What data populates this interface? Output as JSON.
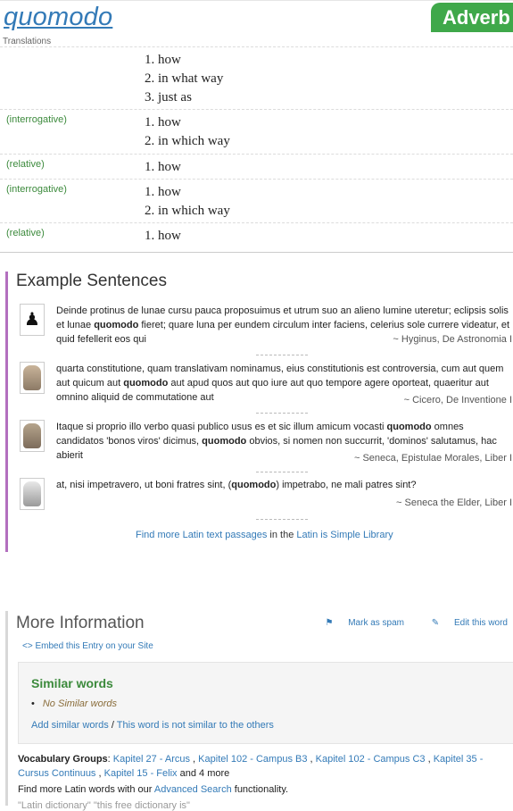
{
  "header": {
    "word": "quomodo",
    "part_of_speech": "Adverb",
    "translations_label": "Translations"
  },
  "translations": [
    {
      "context": "",
      "meanings": [
        "1. how",
        "2. in what way",
        "3. just as"
      ]
    },
    {
      "context": "(interrogative)",
      "meanings": [
        "1. how",
        "2. in which way"
      ]
    },
    {
      "context": "(relative)",
      "meanings": [
        "1. how"
      ]
    },
    {
      "context": "(interrogative)",
      "meanings": [
        "1. how",
        "2. in which way"
      ]
    },
    {
      "context": "(relative)",
      "meanings": [
        "1. how"
      ]
    }
  ],
  "examples": {
    "heading": "Example Sentences",
    "items": [
      {
        "pre": "Deinde protinus de lunae cursu pauca proposuimus et utrum suo an alieno lumine uteretur; eclipsis solis et lunae ",
        "bold1": "quomodo",
        "mid": " fieret; quare luna per eundem circulum inter faciens, celerius sole currere videatur, et quid fefellerit eos qui",
        "bold2": "",
        "post": "",
        "source": "~ Hyginus, De Astronomia I",
        "icon": "bust-icon"
      },
      {
        "pre": "quarta constitutione, quam translativam nominamus, eius constitutionis est controversia, cum aut quem aut quicum aut ",
        "bold1": "quomodo",
        "mid": " aut apud quos aut quo iure aut quo tempore agere oporteat, quaeritur aut omnino aliquid de commutatione aut",
        "bold2": "",
        "post": "",
        "source": "~ Cicero, De Inventione I",
        "icon": "portrait-icon"
      },
      {
        "pre": "Itaque si proprio illo verbo quasi publico usus es et sic illum amicum vocasti ",
        "bold1": "quomodo",
        "mid": " omnes candidatos 'bonos viros' dicimus, ",
        "bold2": "quomodo",
        "post": " obvios, si nomen non succurrit, 'dominos' salutamus, hac abierit",
        "source": "~ Seneca, Epistulae Morales, Liber I",
        "icon": "portrait-icon"
      },
      {
        "pre": "at, nisi impetravero, ut boni fratres sint, (",
        "bold1": "quomodo",
        "mid": ") impetrabo, ne mali patres sint?",
        "bold2": "",
        "post": "",
        "source": "~ Seneca the Elder, Liber I",
        "icon": "statue-icon"
      }
    ],
    "find_more_link": "Find more Latin text passages",
    "find_more_mid": " in the ",
    "library_link": "Latin is Simple Library"
  },
  "more_info": {
    "heading": "More Information",
    "mark_spam": "Mark as spam",
    "edit_word": "Edit this word",
    "embed": "Embed this Entry on your Site",
    "similar_heading": "Similar words",
    "similar_items": [
      "No Similar words"
    ],
    "add_similar": "Add similar words",
    "not_similar": "This word is not similar to the others",
    "vocab_label": "Vocabulary Groups",
    "vocab_groups": [
      "Kapitel 27 - Arcus",
      "Kapitel 102 - Campus B3",
      "Kapitel 102 - Campus C3",
      "Kapitel 35 - Cursus Continuus",
      "Kapitel 15 - Felix"
    ],
    "vocab_more": "and 4 more",
    "adv_pre": "Find more Latin words with our ",
    "adv_link": "Advanced Search",
    "adv_post": " functionality.",
    "cut_line": "\"Latin dictionary\" \"this free dictionary is\""
  }
}
